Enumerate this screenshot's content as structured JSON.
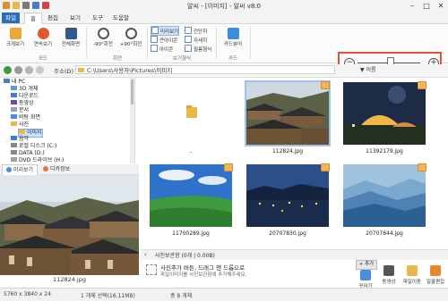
{
  "window": {
    "title": "알씨 - [이미지] - 알씨 v8.0",
    "min": "–",
    "max": "□",
    "close": "✕"
  },
  "menu": {
    "tabs": [
      "파일",
      "홈",
      "편집",
      "보기",
      "도구",
      "도움말"
    ]
  },
  "ribbon": {
    "buttons": [
      "크게보기",
      "연속보기",
      "전체화면",
      "-90°회전",
      "+90°회전",
      "카드뷰어"
    ],
    "view_options": [
      "미리보기",
      "간단히",
      "큰아이콘",
      "자세히",
      "아이콘",
      "필름형식"
    ],
    "groups": [
      "모드",
      "회전",
      "보기형식",
      "카드"
    ]
  },
  "addressbar": {
    "label": "주소(D)",
    "path": "C:\\Users\\사용자\\Pictures\\이미지",
    "sort": "▼ 이름"
  },
  "tree": {
    "items": [
      "내 PC",
      "3D 개체",
      "다운로드",
      "동영상",
      "문서",
      "바탕 화면",
      "사진",
      "이미지",
      "음악",
      "로컬 디스크 (C:)",
      "DATA (D:)",
      "DVD 드라이브 (H:)"
    ]
  },
  "preview_tabs": [
    "미리보기",
    "디카정보"
  ],
  "preview": {
    "caption": "112824.jpg"
  },
  "grid": {
    "items": [
      {
        "name": ".."
      },
      {
        "name": "112824.jpg"
      },
      {
        "name": "11392179.jpg"
      },
      {
        "name": "11700289.jpg"
      },
      {
        "name": "20707830.jpg"
      },
      {
        "name": "20707844.jpg"
      }
    ]
  },
  "picturebox": {
    "title": "사진보관함 (0개 | 0.00B)",
    "message": "사진추가 버튼, 드래그 앤 드롭으로",
    "sub": "파일이미지를 사진보관함에 추가해주세요.",
    "add": "+ 추가",
    "actions": [
      "꾸미기",
      "동영상",
      "파일이동",
      "일괄편집"
    ]
  },
  "status": {
    "dims": "5760 x 3840 x 24",
    "count": "1 개체 선택(16.11MB)",
    "total": "총 8 개체"
  }
}
